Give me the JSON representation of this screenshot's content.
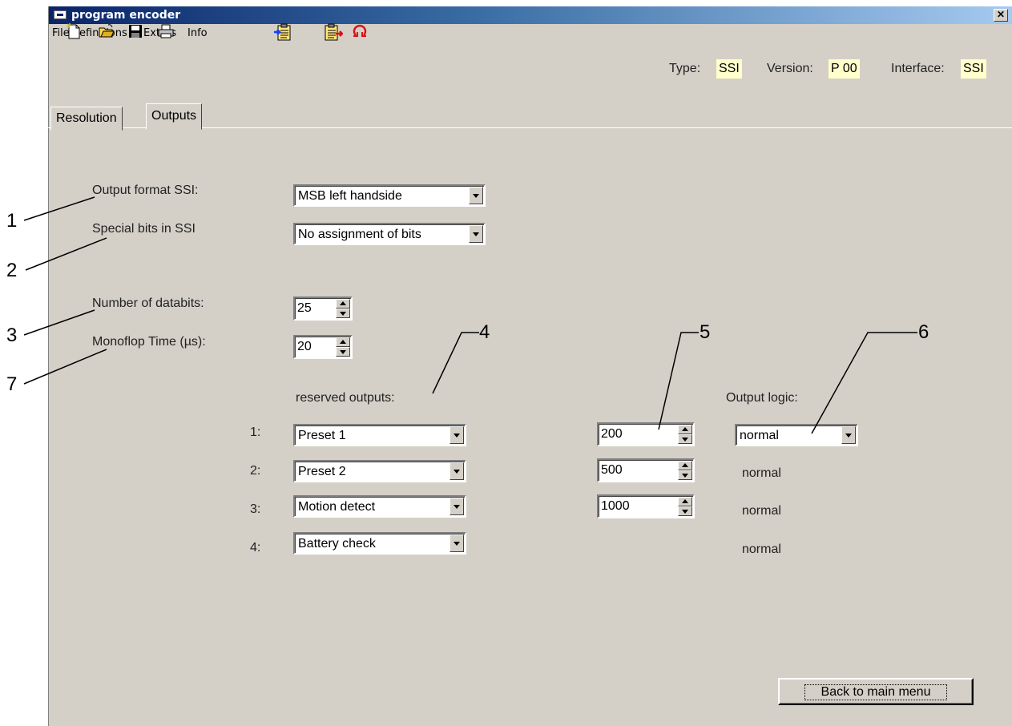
{
  "window": {
    "title": "program encoder",
    "close_glyph": "✕"
  },
  "menu": [
    "File",
    "Definitions",
    "Extras",
    "Info"
  ],
  "toolbar": {
    "icons": [
      "new-file-icon",
      "open-folder-icon",
      "save-disk-icon",
      "printer-icon",
      "clipboard-import-icon",
      "clipboard-export-icon",
      "refresh-icon"
    ],
    "type_label": "Type:",
    "type_value": "SSI",
    "version_label": "Version:",
    "version_value": "P 00",
    "interface_label": "Interface:",
    "interface_value": "SSI"
  },
  "tabs": [
    {
      "label": "Resolution",
      "active": false
    },
    {
      "label": "Outputs",
      "active": true
    }
  ],
  "form": {
    "output_format_label": "Output format SSI:",
    "output_format_value": "MSB left handside",
    "special_bits_label": "Special bits in SSI",
    "special_bits_value": "No assignment of bits",
    "databits_label": "Number of databits:",
    "databits_value": "25",
    "monoflop_label": "Monoflop Time (µs):",
    "monoflop_value": "20",
    "reserved_outputs_label": "reserved outputs:",
    "output_logic_label": "Output logic:",
    "outputs": [
      {
        "index": "1:",
        "function": "Preset 1",
        "value": "200",
        "logic": "normal"
      },
      {
        "index": "2:",
        "function": "Preset 2",
        "value": "500",
        "logic": "normal"
      },
      {
        "index": "3:",
        "function": "Motion detect",
        "value": "1000",
        "logic": "normal"
      },
      {
        "index": "4:",
        "function": "Battery check",
        "value": "",
        "logic": "normal"
      }
    ]
  },
  "callouts": [
    "1",
    "2",
    "3",
    "7",
    "4",
    "5",
    "6"
  ],
  "back_button": "Back to main menu",
  "colors": {
    "titlebar_start": "#0a246a",
    "titlebar_end": "#a6caf0",
    "window_bg": "#d4d0c8",
    "info_value_bg": "#ffffcc"
  }
}
